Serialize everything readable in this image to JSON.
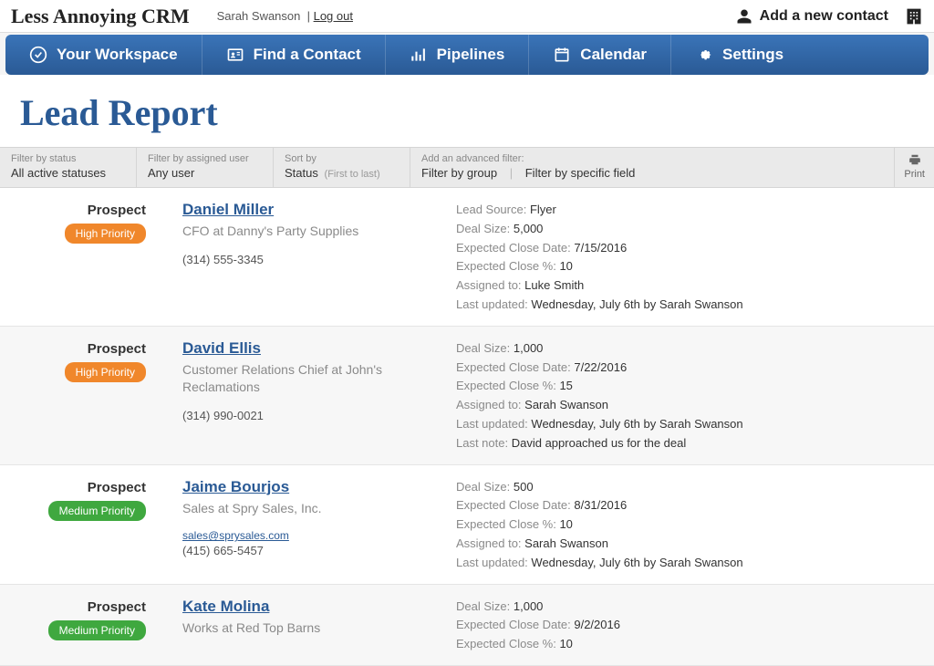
{
  "brand": "Less Annoying CRM",
  "user": {
    "name": "Sarah Swanson",
    "logout": "Log out"
  },
  "top_actions": {
    "add_contact": "Add a new contact"
  },
  "nav": {
    "workspace": "Your Workspace",
    "find_contact": "Find a Contact",
    "pipelines": "Pipelines",
    "calendar": "Calendar",
    "settings": "Settings"
  },
  "page": {
    "title": "Lead Report"
  },
  "filters": {
    "status": {
      "label": "Filter by status",
      "value": "All active statuses"
    },
    "assigned": {
      "label": "Filter by assigned user",
      "value": "Any user"
    },
    "sort": {
      "label": "Sort by",
      "value": "Status",
      "hint": "(First to last)"
    },
    "advanced": {
      "label": "Add an advanced filter:",
      "by_group": "Filter by group",
      "by_field": "Filter by specific field"
    },
    "print": "Print"
  },
  "leads": [
    {
      "status": "Prospect",
      "priority": "High Priority",
      "priority_class": "high",
      "name": "Daniel Miller",
      "title": "CFO at Danny's Party Supplies",
      "email": "",
      "phone": "(314) 555-3345",
      "details": [
        {
          "label": "Lead Source:",
          "value": "Flyer"
        },
        {
          "label": "Deal Size:",
          "value": "5,000"
        },
        {
          "label": "Expected Close Date:",
          "value": "7/15/2016"
        },
        {
          "label": "Expected Close %:",
          "value": "10"
        },
        {
          "label": "Assigned to:",
          "value": "Luke Smith"
        },
        {
          "label": "Last updated:",
          "value": "Wednesday, July 6th by Sarah Swanson"
        }
      ]
    },
    {
      "status": "Prospect",
      "priority": "High Priority",
      "priority_class": "high",
      "name": "David Ellis",
      "title": "Customer Relations Chief at John's Reclamations",
      "email": "",
      "phone": "(314) 990-0021",
      "details": [
        {
          "label": "Deal Size:",
          "value": "1,000"
        },
        {
          "label": "Expected Close Date:",
          "value": "7/22/2016"
        },
        {
          "label": "Expected Close %:",
          "value": "15"
        },
        {
          "label": "Assigned to:",
          "value": "Sarah Swanson"
        },
        {
          "label": "Last updated:",
          "value": "Wednesday, July 6th by Sarah Swanson"
        },
        {
          "label": "Last note:",
          "value": "David approached us for the deal"
        }
      ]
    },
    {
      "status": "Prospect",
      "priority": "Medium Priority",
      "priority_class": "medium",
      "name": "Jaime Bourjos",
      "title": "Sales at Spry Sales, Inc.",
      "email": "sales@sprysales.com",
      "phone": "(415) 665-5457",
      "details": [
        {
          "label": "Deal Size:",
          "value": "500"
        },
        {
          "label": "Expected Close Date:",
          "value": "8/31/2016"
        },
        {
          "label": "Expected Close %:",
          "value": "10"
        },
        {
          "label": "Assigned to:",
          "value": "Sarah Swanson"
        },
        {
          "label": "Last updated:",
          "value": "Wednesday, July 6th by Sarah Swanson"
        }
      ]
    },
    {
      "status": "Prospect",
      "priority": "Medium Priority",
      "priority_class": "medium",
      "name": "Kate Molina",
      "title": "Works at Red Top Barns",
      "email": "",
      "phone": "",
      "details": [
        {
          "label": "Deal Size:",
          "value": "1,000"
        },
        {
          "label": "Expected Close Date:",
          "value": "9/2/2016"
        },
        {
          "label": "Expected Close %:",
          "value": "10"
        }
      ]
    }
  ]
}
